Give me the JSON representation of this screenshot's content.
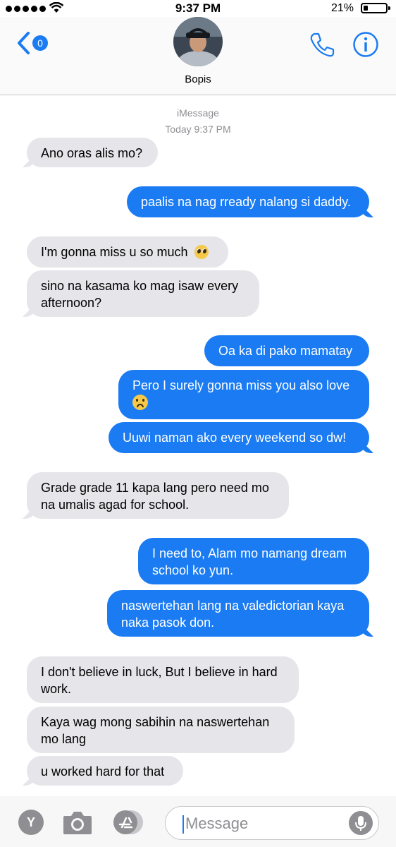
{
  "status_bar": {
    "time": "9:37 PM",
    "battery_percent": "21%",
    "battery_level": 0.21
  },
  "header": {
    "back_badge": "0",
    "contact_name": "Bopis"
  },
  "conversation": {
    "service": "iMessage",
    "timestamp": "Today 9:37 PM"
  },
  "messages": [
    {
      "direction": "incoming",
      "text": "Ano oras alis mo?"
    },
    {
      "direction": "outgoing",
      "text": "paalis na nag rready nalang si daddy."
    },
    {
      "direction": "incoming",
      "text": "I'm gonna miss u so much",
      "emoji": "pleading-face-emoji"
    },
    {
      "direction": "incoming",
      "text": "sino na kasama ko mag isaw every afternoon?"
    },
    {
      "direction": "outgoing",
      "text": "Oa ka di pako mamatay"
    },
    {
      "direction": "outgoing",
      "text": "Pero I surely gonna miss you also love",
      "emoji": "frowning-face-emoji"
    },
    {
      "direction": "outgoing",
      "text": "Uuwi naman ako every weekend so dw!"
    },
    {
      "direction": "incoming",
      "text": "Grade grade 11 kapa lang pero need mo na umalis agad for school."
    },
    {
      "direction": "outgoing",
      "text": "I need to, Alam mo namang dream school ko yun."
    },
    {
      "direction": "outgoing",
      "text": "naswertehan lang na valedictorian kaya naka pasok don."
    },
    {
      "direction": "incoming",
      "text": "I don't believe in luck, But I believe in hard work."
    },
    {
      "direction": "incoming",
      "text": "Kaya wag mong sabihin na naswertehan mo lang"
    },
    {
      "direction": "incoming",
      "text": "u worked hard for that"
    }
  ],
  "input_bar": {
    "apps_button": "Y",
    "placeholder": "Message"
  },
  "colors": {
    "accent": "#1a7bf2",
    "incoming_bubble": "#e5e5ea",
    "outgoing_bubble": "#1a7bf2",
    "meta_text": "#8e8e93"
  }
}
